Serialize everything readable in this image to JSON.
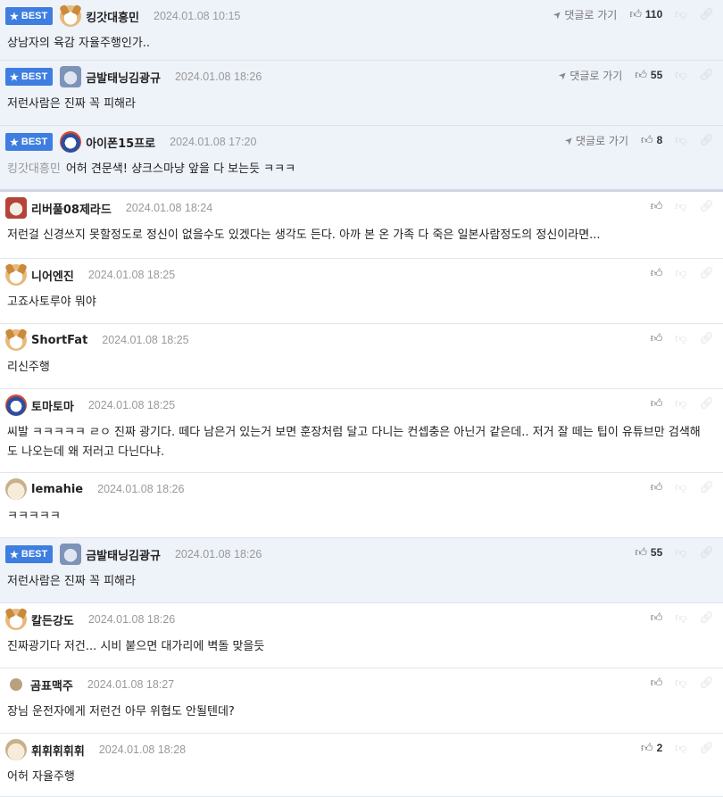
{
  "best_label": "BEST",
  "reply_label": "댓글로 가기",
  "comments": [
    {
      "best": true,
      "avatar": "av-dog",
      "nick": "킹갓대흥민",
      "date": "2024.01.08 10:15",
      "likes": "110",
      "reply_link": true,
      "mention": "",
      "text": "상남자의 육감 자율주행인가.."
    },
    {
      "best": true,
      "avatar": "av-koala",
      "nick": "금발태닝김광규",
      "date": "2024.01.08 18:26",
      "likes": "55",
      "reply_link": true,
      "mention": "",
      "text": "저런사람은 진짜 꼭 피해라"
    },
    {
      "best": true,
      "avatar": "av-bear",
      "nick": "아이폰15프로",
      "date": "2024.01.08 17:20",
      "likes": "8",
      "reply_link": true,
      "mention": "킹갓대흥민",
      "text": "어허 견문색! 샹크스마냥 앞을 다 보는듯 ㅋㅋㅋ"
    },
    {
      "best": false,
      "avatar": "av-pug",
      "nick": "리버풀08제라드",
      "date": "2024.01.08 18:24",
      "likes": "",
      "reply_link": false,
      "mention": "",
      "text": "저런걸 신경쓰지 못할정도로 정신이 없을수도 있겠다는 생각도 든다. 아까 본 온 가족 다 죽은 일본사람정도의 정신이라면..."
    },
    {
      "best": false,
      "avatar": "av-dog",
      "nick": "니어엔진",
      "date": "2024.01.08 18:25",
      "likes": "",
      "reply_link": false,
      "mention": "",
      "text": "고죠사토루야 뭐야"
    },
    {
      "best": false,
      "avatar": "av-dog",
      "nick": "ShortFat",
      "date": "2024.01.08 18:25",
      "likes": "",
      "reply_link": false,
      "mention": "",
      "text": "리신주행"
    },
    {
      "best": false,
      "avatar": "av-bear",
      "nick": "토마토마",
      "date": "2024.01.08 18:25",
      "likes": "",
      "reply_link": false,
      "mention": "",
      "text": "씨발 ㅋㅋㅋㅋㅋ ㄹㅇ 진짜 광기다. 떼다 남은거 있는거 보면 훈장처럼 달고 다니는 컨셉충은 아닌거 같은데.. 저거 잘 떼는 팁이 유튜브만 검색해도 나오는데 왜 저러고 다닌다냐."
    },
    {
      "best": false,
      "avatar": "av-puppy",
      "nick": "lemahie",
      "date": "2024.01.08 18:26",
      "likes": "",
      "reply_link": false,
      "mention": "",
      "text": "ㅋㅋㅋㅋㅋ"
    },
    {
      "best": true,
      "avatar": "av-koala",
      "nick": "금발태닝김광규",
      "date": "2024.01.08 18:26",
      "likes": "55",
      "reply_link": false,
      "mention": "",
      "text": "저런사람은 진짜 꼭 피해라"
    },
    {
      "best": false,
      "avatar": "av-dog",
      "nick": "칼든강도",
      "date": "2024.01.08 18:26",
      "likes": "",
      "reply_link": false,
      "mention": "",
      "text": "진짜광기다 저건... 시비 붙으면 대가리에 벽돌 맞을듯"
    },
    {
      "best": false,
      "avatar": "av-ball",
      "nick": "곰표맥주",
      "date": "2024.01.08 18:27",
      "likes": "",
      "reply_link": false,
      "mention": "",
      "text": "장님 운전자에게 저런건 아무 위협도 안될텐데?"
    },
    {
      "best": false,
      "avatar": "av-puppy",
      "nick": "휘휘휘휘휘",
      "date": "2024.01.08 18:28",
      "likes": "2",
      "reply_link": false,
      "mention": "",
      "text": "어허 자율주행"
    }
  ]
}
